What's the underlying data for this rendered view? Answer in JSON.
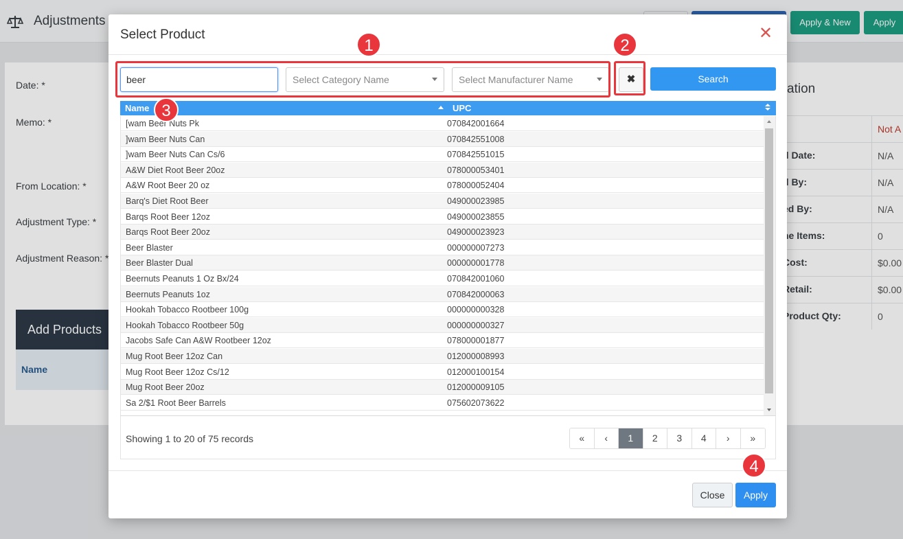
{
  "background": {
    "header": {
      "title": "Adjustments",
      "buttons": [
        "",
        "",
        "Apply & New",
        "Apply"
      ]
    },
    "form": {
      "labels": [
        "Date: *",
        "Memo: *",
        "From Location: *",
        "Adjustment Type: *",
        "Adjustment Reason: *"
      ],
      "add_products": "Add Products",
      "name_header": "Name"
    },
    "info": {
      "title": "ation",
      "rows": [
        {
          "label": ":",
          "value": "Not A"
        },
        {
          "label": "d Date:",
          "value": "N/A"
        },
        {
          "label": "d By:",
          "value": "N/A"
        },
        {
          "label": "ed By:",
          "value": "N/A"
        },
        {
          "label": "ne Items:",
          "value": "0"
        },
        {
          "label": "Cost:",
          "value": "$0.00"
        },
        {
          "label": "Retail:",
          "value": "$0.00"
        },
        {
          "label": "Product Qty:",
          "value": "0"
        }
      ]
    }
  },
  "modal": {
    "title": "Select Product",
    "close_icon": "close-icon",
    "search": {
      "value": "beer",
      "category_placeholder": "Select Category Name",
      "manufacturer_placeholder": "Select Manufacturer Name",
      "clear_icon": "clear-icon",
      "search_label": "Search"
    },
    "grid": {
      "columns": [
        "Name",
        "UPC"
      ],
      "rows": [
        {
          "name": "[wam Beer Nuts Pk",
          "upc": "070842001664"
        },
        {
          "name": "]wam Beer Nuts Can",
          "upc": "070842551008"
        },
        {
          "name": "]wam Beer Nuts Can Cs/6",
          "upc": "070842551015"
        },
        {
          "name": "A&W Diet Root Beer 20oz",
          "upc": "078000053401"
        },
        {
          "name": "A&W Root Beer 20 oz",
          "upc": "078000052404"
        },
        {
          "name": "Barq's Diet Root Beer",
          "upc": "049000023985"
        },
        {
          "name": "Barqs Root Beer 12oz",
          "upc": "049000023855"
        },
        {
          "name": "Barqs Root Beer 20oz",
          "upc": "049000023923"
        },
        {
          "name": "Beer Blaster",
          "upc": "000000007273"
        },
        {
          "name": "Beer Blaster Dual",
          "upc": "000000001778"
        },
        {
          "name": "Beernuts Peanuts 1 Oz Bx/24",
          "upc": "070842001060"
        },
        {
          "name": "Beernuts Peanuts 1oz",
          "upc": "070842000063"
        },
        {
          "name": "Hookah Tobacco Rootbeer 100g",
          "upc": "000000000328"
        },
        {
          "name": "Hookah Tobacco Rootbeer 50g",
          "upc": "000000000327"
        },
        {
          "name": "Jacobs Safe Can A&W Rootbeer 12oz",
          "upc": "078000001877"
        },
        {
          "name": "Mug Root Beer 12oz Can",
          "upc": "012000008993"
        },
        {
          "name": "Mug Root Beer 12oz Cs/12",
          "upc": "012000100154"
        },
        {
          "name": "Mug Root Beer 20oz",
          "upc": "012000009105"
        },
        {
          "name": "Sa 2/$1 Root Beer Barrels",
          "upc": "075602073622"
        }
      ],
      "records_text": "Showing 1 to 20 of 75 records",
      "pager": [
        "«",
        "‹",
        "1",
        "2",
        "3",
        "4",
        "›",
        "»"
      ],
      "active_page": "1"
    },
    "footer": {
      "close_label": "Close",
      "apply_label": "Apply"
    }
  },
  "callouts": [
    "1",
    "2",
    "3",
    "4"
  ],
  "colors": {
    "accent": "#3d9cf0",
    "callout": "#e8363c",
    "close_icon": "#d9534f",
    "green_button": "#1c9e82"
  }
}
